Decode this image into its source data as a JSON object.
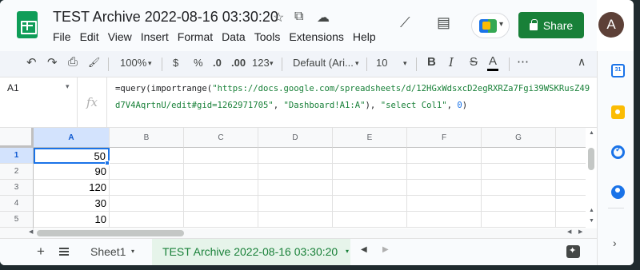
{
  "doc": {
    "title": "TEST Archive 2022-08-16 03:30:20",
    "star_icon": "☆",
    "move_icon": "⧉",
    "cloud_icon": "☁"
  },
  "menu": [
    "File",
    "Edit",
    "View",
    "Insert",
    "Format",
    "Data",
    "Tools",
    "Extensions",
    "Help"
  ],
  "header": {
    "trend_icon": "⟋",
    "comment_icon": "▤",
    "share_label": "Share",
    "avatar_letter": "A",
    "meet_caret": "▾"
  },
  "toolbar": {
    "undo_icon": "↶",
    "redo_icon": "↷",
    "print_icon": "⎙",
    "paint_icon": "🖌",
    "zoom": "100%",
    "zoom_caret": "▾",
    "currency": "$",
    "percent": "%",
    "dec_decrease": ".0",
    "dec_increase": ".00",
    "number_format": "123",
    "font": "Default (Ari...",
    "font_size": "10",
    "bold": "B",
    "italic": "I",
    "strike": "S",
    "text_color": "A",
    "more": "⋯",
    "collapse": "∧"
  },
  "formula_bar": {
    "name_box": "A1",
    "name_caret": "▾",
    "fx": "fx",
    "f1": "=query(importrange(",
    "f2": "\"https://docs.google.com/spreadsheets/d/12HGxWdsxcD2egRXRZa7Fgi39WSKRusZ49d7V4AqrtnU/edit#gid=1262971705\"",
    "f3": ",  ",
    "f4": "\"Dashboard!A1:A\"",
    "f5": "), ",
    "f6": "\"select Col1\"",
    "f7": ", ",
    "f8": "0",
    "f9": ")"
  },
  "grid": {
    "columns": [
      "A",
      "B",
      "C",
      "D",
      "E",
      "F",
      "G"
    ],
    "rows": [
      "1",
      "2",
      "3",
      "4",
      "5"
    ],
    "column_a_values": [
      "50",
      "90",
      "120",
      "30",
      "10"
    ],
    "active_cell": "A1"
  },
  "tabs": {
    "plus_icon": "+",
    "sheet1": "Sheet1",
    "active_sheet": "TEST Archive 2022-08-16 03:30:20",
    "caret": "▾",
    "nav_left": "◀",
    "nav_right": "▶"
  },
  "side": {
    "calendar_label": "31",
    "chevron": "›"
  },
  "colors": {
    "share": "#188038",
    "accent": "#1a73e8",
    "active_tab": "#188038"
  }
}
